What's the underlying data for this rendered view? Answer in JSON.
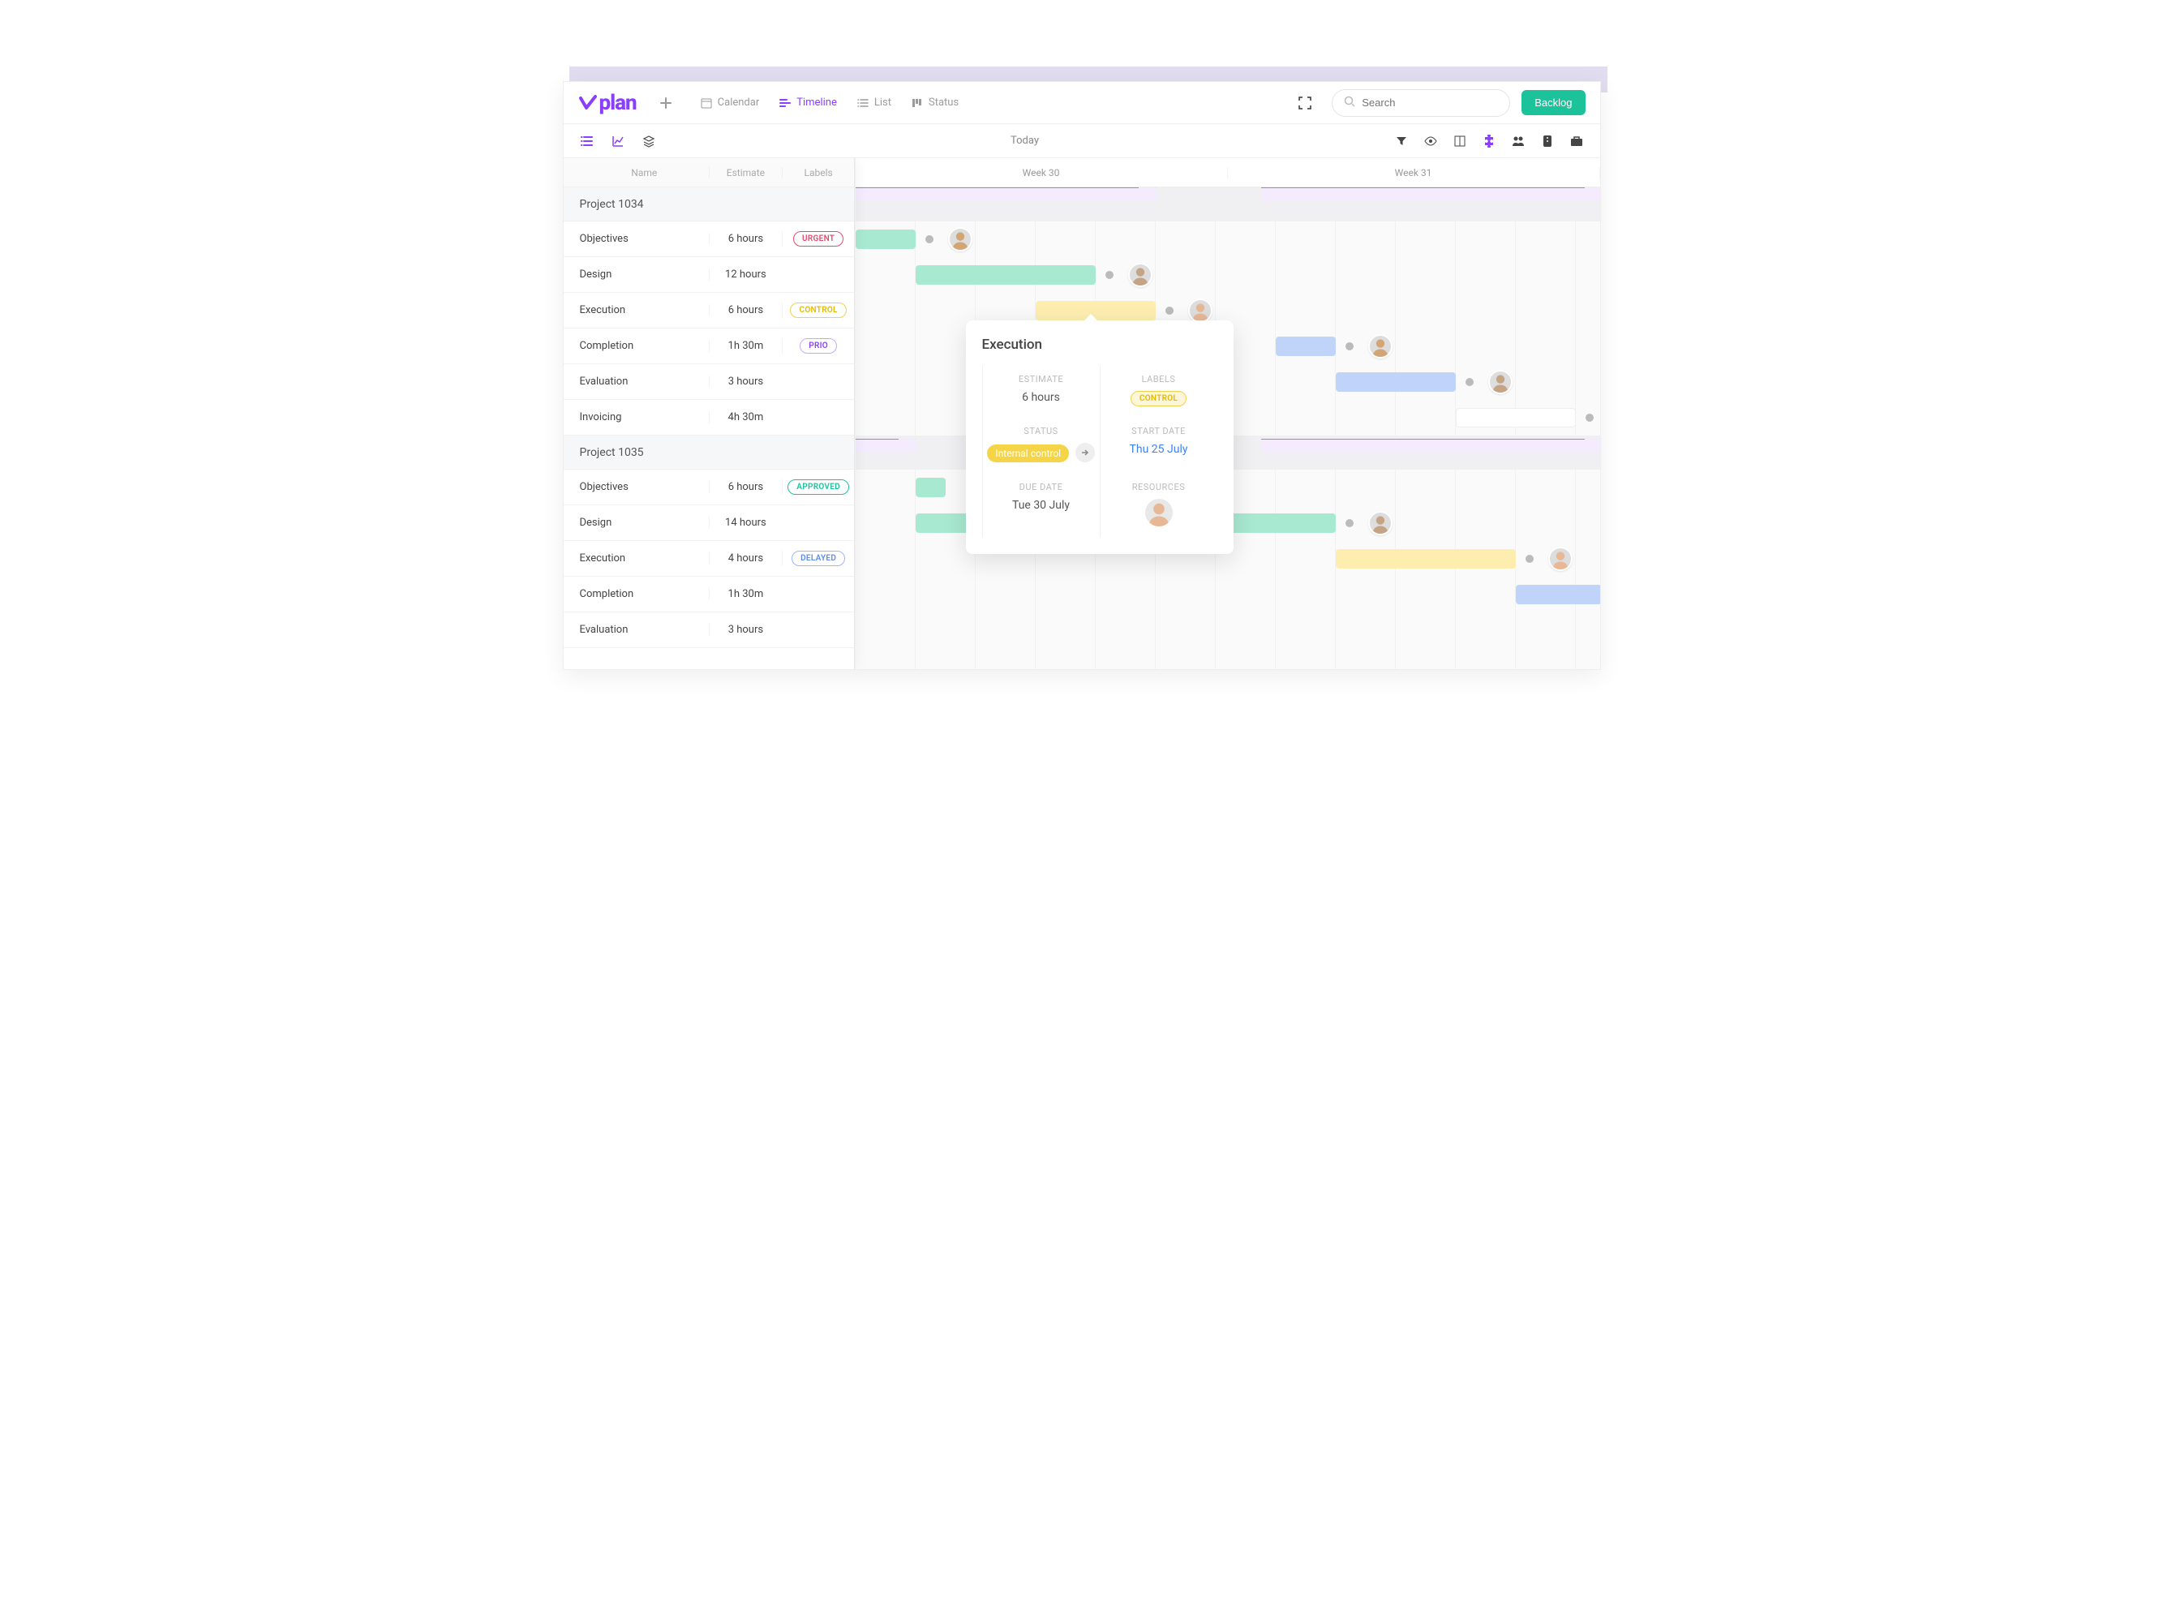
{
  "logo": "plan",
  "viewTabs": {
    "calendar": "Calendar",
    "timeline": "Timeline",
    "list": "List",
    "status": "Status"
  },
  "search": {
    "placeholder": "Search"
  },
  "backlog": "Backlog",
  "today": "Today",
  "weeks": [
    "Week 30",
    "Week 31"
  ],
  "columns": {
    "name": "Name",
    "estimate": "Estimate",
    "labels": "Labels"
  },
  "projects": [
    {
      "title": "Project 1034",
      "tasks": [
        {
          "name": "Objectives",
          "estimate": "6 hours",
          "label": "URGENT",
          "labelClass": "badge-urgent"
        },
        {
          "name": "Design",
          "estimate": "12 hours",
          "label": "",
          "labelClass": ""
        },
        {
          "name": "Execution",
          "estimate": "6 hours",
          "label": "CONTROL",
          "labelClass": "badge-control"
        },
        {
          "name": "Completion",
          "estimate": "1h 30m",
          "label": "PRIO",
          "labelClass": "badge-prio"
        },
        {
          "name": "Evaluation",
          "estimate": "3 hours",
          "label": "",
          "labelClass": ""
        },
        {
          "name": "Invoicing",
          "estimate": "4h 30m",
          "label": "",
          "labelClass": ""
        }
      ]
    },
    {
      "title": "Project 1035",
      "tasks": [
        {
          "name": "Objectives",
          "estimate": "6 hours",
          "label": "APPROVED",
          "labelClass": "badge-approved"
        },
        {
          "name": "Design",
          "estimate": "14 hours",
          "label": "",
          "labelClass": ""
        },
        {
          "name": "Execution",
          "estimate": "4 hours",
          "label": "DELAYED",
          "labelClass": "badge-delayed"
        },
        {
          "name": "Completion",
          "estimate": "1h 30m",
          "label": "",
          "labelClass": ""
        },
        {
          "name": "Evaluation",
          "estimate": "3 hours",
          "label": "",
          "labelClass": ""
        }
      ]
    }
  ],
  "popover": {
    "title": "Execution",
    "estimateLabel": "ESTIMATE",
    "estimate": "6 hours",
    "labelsLabel": "LABELS",
    "labelBadge": "CONTROL",
    "statusLabel": "STATUS",
    "status": "Internal control",
    "startDateLabel": "START DATE",
    "startDate": "Thu 25 July",
    "dueDateLabel": "DUE DATE",
    "dueDate": "Tue 30 July",
    "resourcesLabel": "RESOURCES"
  },
  "colors": {
    "accent": "#8a3ffc",
    "green": "#1cc29a"
  }
}
